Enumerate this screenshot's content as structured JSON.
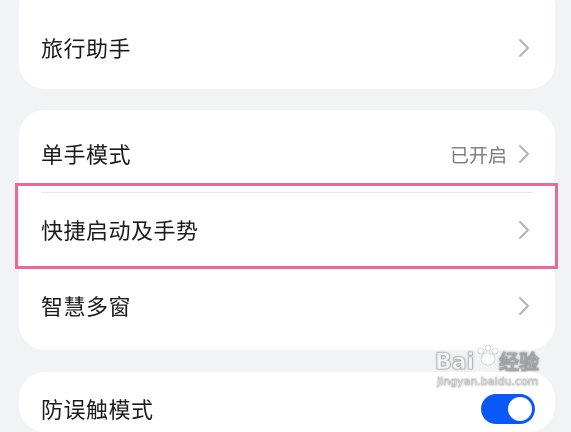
{
  "settings": {
    "card1": {
      "travel_assistant": "旅行助手"
    },
    "card2": {
      "one_handed_mode": {
        "label": "单手模式",
        "value": "已开启"
      },
      "quick_launch_gestures": {
        "label": "快捷启动及手势"
      },
      "smart_multi_window": {
        "label": "智慧多窗"
      }
    },
    "card3": {
      "partial_label": "防误触模式",
      "toggle_on": true
    }
  },
  "icons": {
    "chevron": "chevron-right-icon"
  },
  "colors": {
    "highlight": "#e8699a",
    "toggle_active": "#0a59f7"
  }
}
